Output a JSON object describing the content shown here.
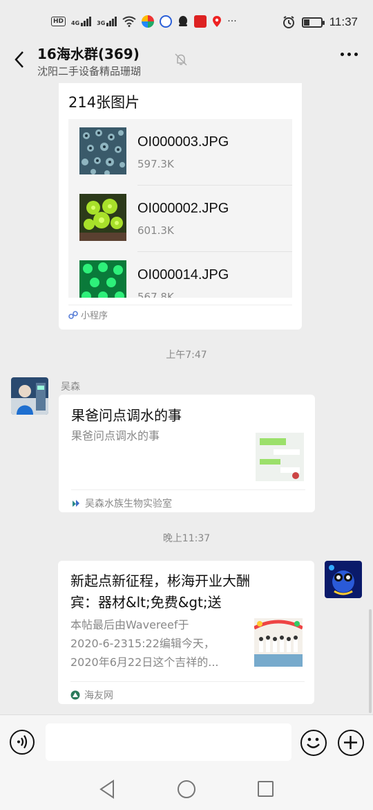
{
  "status_bar": {
    "hd_badge": "HD",
    "net_4g": "4G",
    "net_3g": "3G",
    "time": "11:37",
    "more": "···"
  },
  "header": {
    "title": "16海水群(369)",
    "subtitle": "沈阳二手设备精品珊瑚"
  },
  "messages": {
    "mini_program": {
      "title": "214张图片",
      "files": [
        {
          "name": "OI000003.JPG",
          "size": "597.3K"
        },
        {
          "name": "OI000002.JPG",
          "size": "601.3K"
        },
        {
          "name": "OI000014.JPG",
          "size": "567.8K"
        }
      ],
      "footer": "小程序"
    },
    "time1": "上午7:47",
    "msg1": {
      "sender": "吴森",
      "title": "果爸问点调水的事",
      "desc": "果爸问点调水的事",
      "source": "吴森水族生物实验室"
    },
    "time2": "晚上11:37",
    "msg2": {
      "title_line1": "新起点新征程，彬海开业大酬",
      "title_line2": "宾：器材&lt;免费&gt;送",
      "desc_line1": "本帖最后由Wavereef于",
      "desc_line2": "2020-6-2315:22编辑今天，",
      "desc_line3": "2020年6月22日这个吉祥的...",
      "source": "海友网"
    }
  },
  "colors": {
    "background": "#ededed",
    "card": "#ffffff",
    "muted_text": "#888888"
  }
}
